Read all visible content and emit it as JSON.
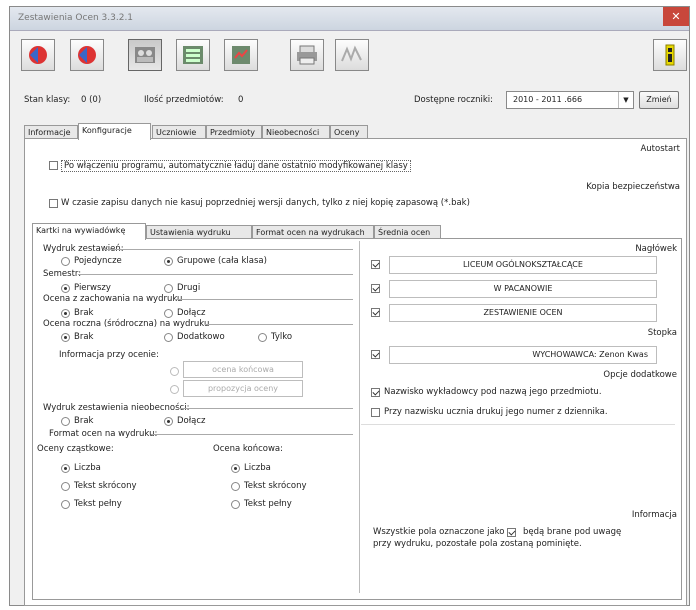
{
  "window": {
    "title": "Zestawienia Ocen 3.3.2.1",
    "close": "✕"
  },
  "toolbar": {
    "buttons": [
      "record-red-icon",
      "record-red-down-icon",
      "class-photo-icon",
      "settings-table-icon",
      "report-icon",
      "print-icon",
      "sign-icon",
      "info-icon"
    ]
  },
  "status": {
    "stan_label": "Stan klasy:",
    "stan_value": "0 (0)",
    "przedmioty_label": "Ilość przedmiotów:",
    "przedmioty_value": "0",
    "rocznik_label": "Dostępne roczniki:",
    "rocznik_value": "2010 - 2011 .666",
    "change_btn": "Zmień"
  },
  "main_tabs": [
    "Informacje",
    "Konfiguracje",
    "Uczniowie",
    "Przedmioty",
    "Nieobecności",
    "Oceny"
  ],
  "konfig": {
    "autostart_label": "Autostart",
    "autostart_cb": "Po włączeniu programu, automatycznie ładuj dane ostatnio modyfikowanej klasy",
    "kopia_label": "Kopia bezpieczeństwa",
    "kopia_cb": "W czasie zapisu danych nie kasuj poprzedniej wersji danych, tylko z niej kopię zapasową (*.bak)"
  },
  "sub_tabs": [
    "Kartki na wywiadówkę",
    "Ustawienia wydruku",
    "Format ocen na wydrukach",
    "Średnia ocen"
  ],
  "left": {
    "wydruk_label": "Wydruk zestawień:",
    "wydruk_opts": [
      "Pojedyncze",
      "Grupowe (cała klasa)"
    ],
    "semestr_label": "Semestr:",
    "semestr_opts": [
      "Pierwszy",
      "Drugi"
    ],
    "zach_label": "Ocena z zachowania na wydruku",
    "zach_opts": [
      "Brak",
      "Dołącz"
    ],
    "roczna_label": "Ocena roczna (śródroczna) na wydruku",
    "roczna_opts": [
      "Brak",
      "Dodatkowo",
      "Tylko"
    ],
    "info_przy_label": "Informacja przy ocenie:",
    "info_przy_fields": [
      "ocena końcowa",
      "propozycja oceny"
    ],
    "nieob_label": "Wydruk zestawienia nieobecności:",
    "nieob_opts": [
      "Brak",
      "Dołącz"
    ],
    "format_label": "Format ocen na wydruku:",
    "czastkowe_label": "Oceny cząstkowe:",
    "koncowa_label": "Ocena końcowa:",
    "format_opts": [
      "Liczba",
      "Tekst skrócony",
      "Tekst pełny"
    ]
  },
  "right": {
    "naglowek_label": "Nagłówek",
    "naglowek_lines": [
      "LICEUM OGÓLNOKSZTAŁCĄCE",
      "W PACANOWIE",
      "ZESTAWIENIE OCEN"
    ],
    "stopka_label": "Stopka",
    "stopka_line": "WYCHOWAWCA: Zenon Kwas",
    "opcje_label": "Opcje dodatkowe",
    "opcje_cb": [
      "Nazwisko wykładowcy pod nazwą jego przedmiotu.",
      "Przy nazwisku ucznia drukuj jego numer z dziennika."
    ],
    "informacja_label": "Informacja",
    "info_text1": "Wszystkie pola oznaczone jako",
    "info_text2": "będą brane pod uwagę",
    "info_text3": "przy wydruku, pozostałe pola zostaną pominięte."
  }
}
